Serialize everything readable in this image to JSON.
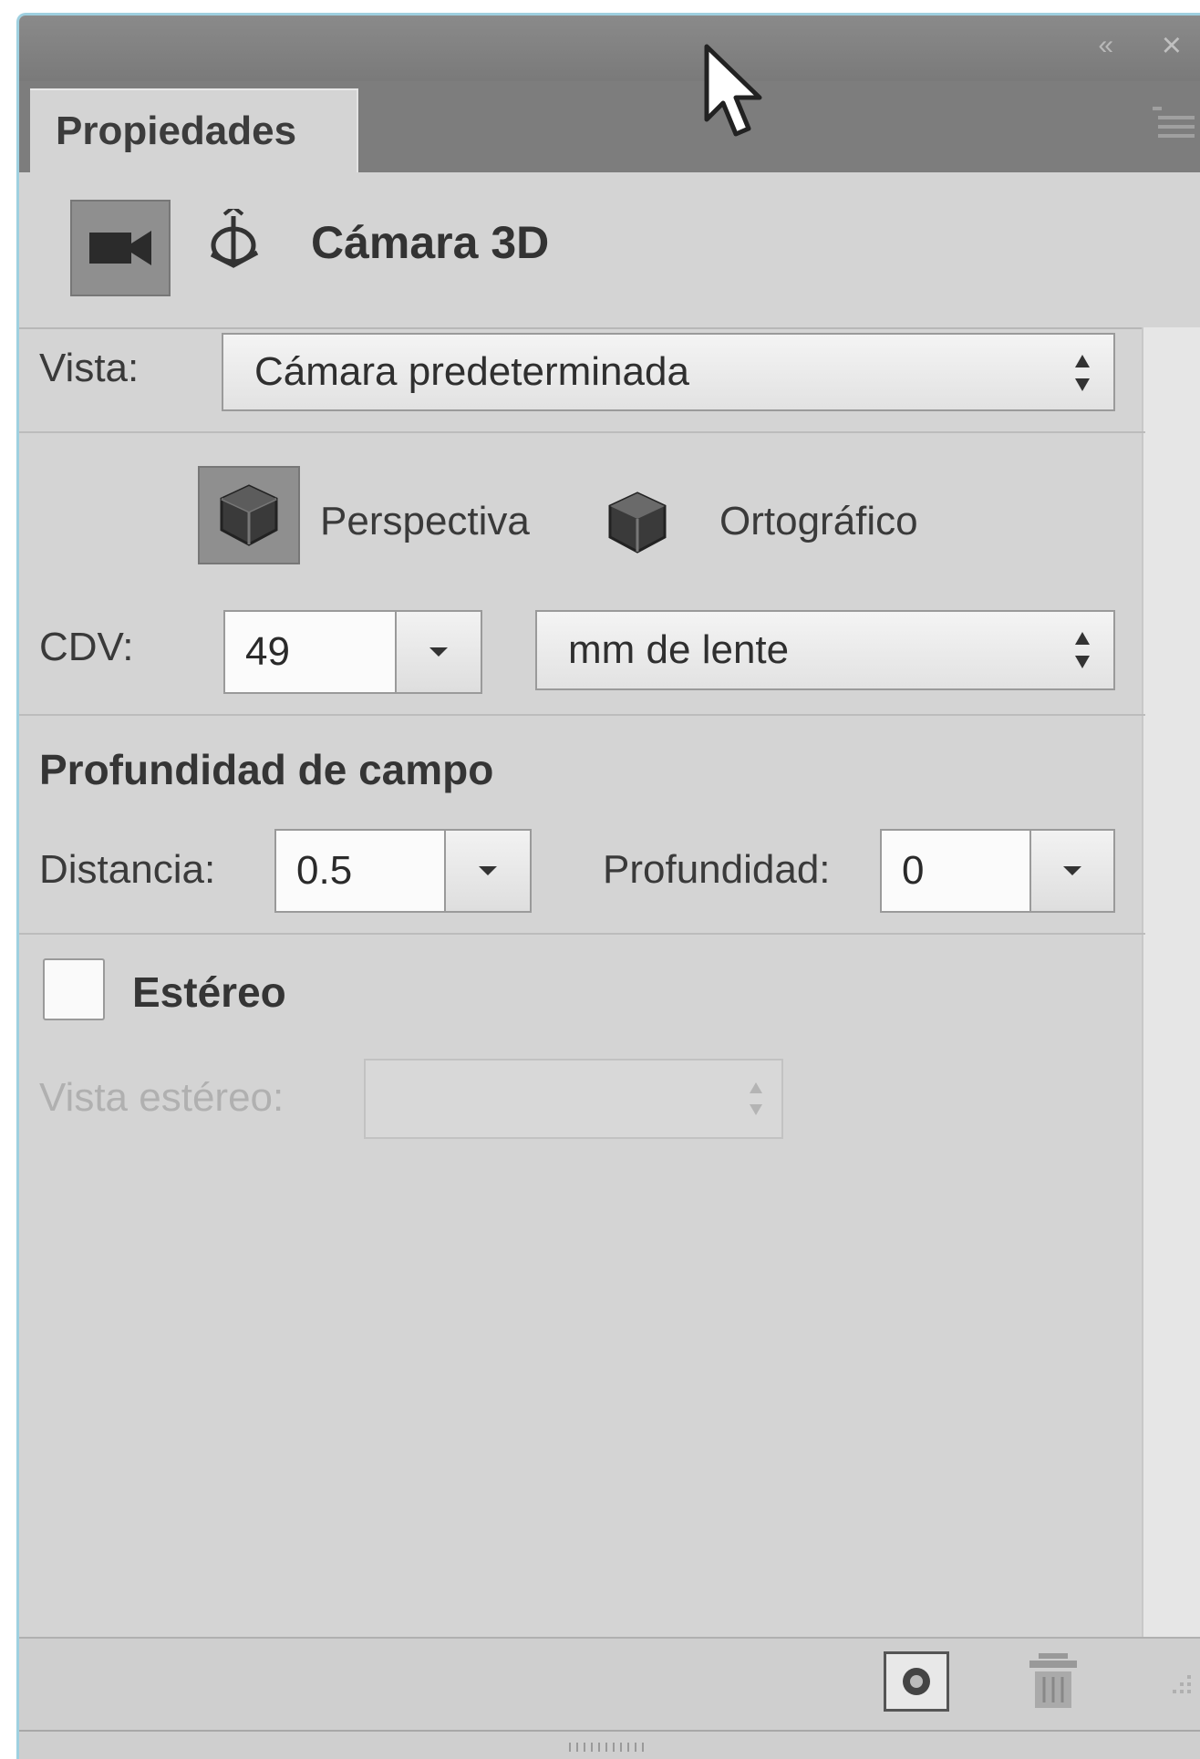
{
  "panel": {
    "tab_label": "Propiedades",
    "header_title": "Cámara 3D",
    "vista": {
      "label": "Vista:",
      "value": "Cámara predeterminada"
    },
    "projection": {
      "perspective_label": "Perspectiva",
      "orthographic_label": "Ortográfico",
      "selected": "Perspectiva"
    },
    "cdv": {
      "label": "CDV:",
      "value": "49",
      "unit_value": "mm de lente"
    },
    "depth_of_field": {
      "title": "Profundidad de campo",
      "distance_label": "Distancia:",
      "distance_value": "0.5",
      "depth_label": "Profundidad:",
      "depth_value": "0"
    },
    "stereo": {
      "label": "Estéreo",
      "checked": false,
      "view_label": "Vista estéreo:",
      "view_value": ""
    }
  },
  "icons": [
    "collapse-icon",
    "close-icon",
    "panel-menu-icon",
    "mouse-cursor-icon",
    "video-camera-icon",
    "orbit-axis-icon",
    "cube-icon",
    "sort-arrows-icon",
    "dropdown-arrow-icon",
    "render-icon",
    "trash-icon"
  ],
  "colors": {
    "panel_bg": "#d4d4d4",
    "title_bar": "#7d7d7d",
    "selected_button": "#8f8f8f",
    "window_border": "#9fd0e0"
  }
}
